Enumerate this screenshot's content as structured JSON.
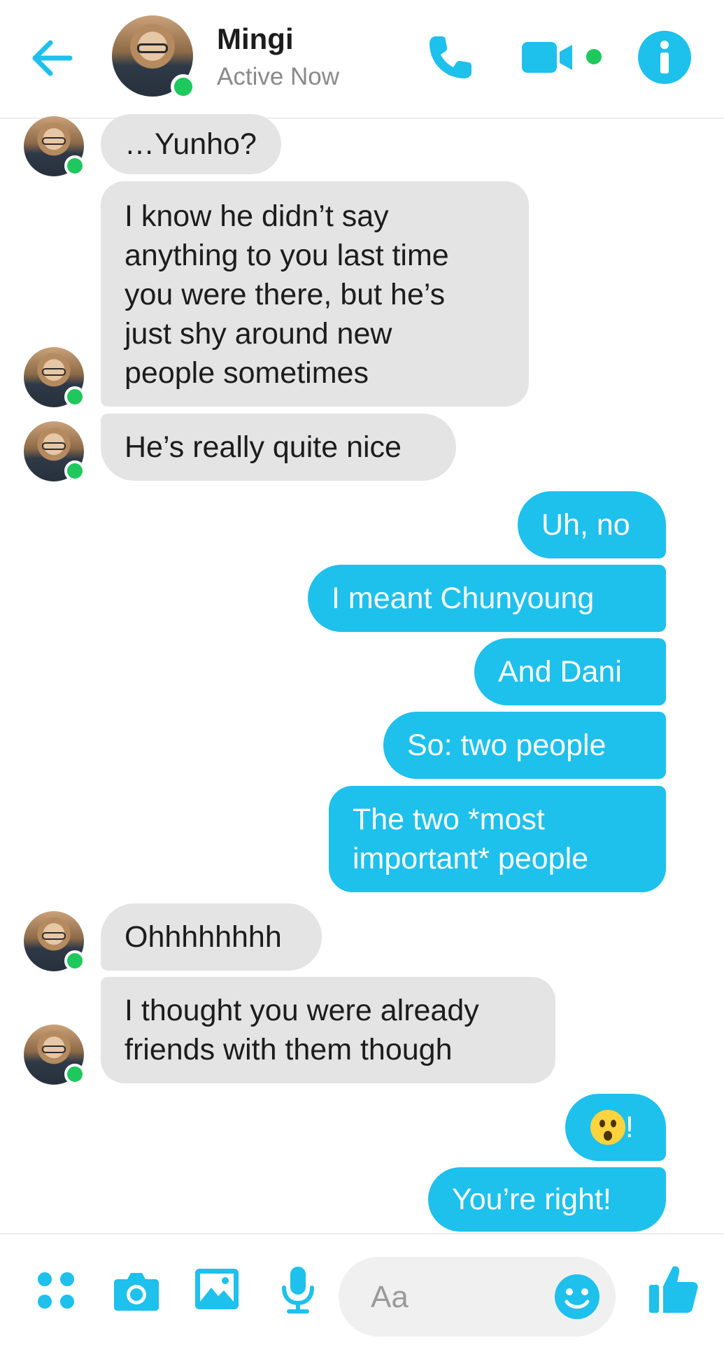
{
  "header": {
    "contact_name": "Mingi",
    "status": "Active Now",
    "accent_color": "#1ec0ec",
    "online_color": "#1ec85c",
    "icons": [
      "back-arrow-icon",
      "phone-icon",
      "video-camera-icon",
      "info-icon"
    ]
  },
  "messages": [
    {
      "side": "in",
      "lines": [
        "…Yunho?"
      ]
    },
    {
      "side": "in",
      "lines": [
        "I know he didn’t say",
        "anything to you last time",
        "you were there, but he’s",
        "just shy around new",
        "people sometimes"
      ]
    },
    {
      "side": "in",
      "lines": [
        "He’s really quite nice"
      ]
    },
    {
      "side": "out",
      "lines": [
        "Uh, no"
      ]
    },
    {
      "side": "out",
      "lines": [
        "I meant Chunyoung"
      ]
    },
    {
      "side": "out",
      "lines": [
        "And Dani"
      ]
    },
    {
      "side": "out",
      "lines": [
        "So: two people"
      ]
    },
    {
      "side": "out",
      "lines": [
        "The two *most",
        "important* people"
      ]
    },
    {
      "side": "in",
      "lines": [
        "Ohhhhhhhh"
      ]
    },
    {
      "side": "in",
      "lines": [
        "I thought you were already",
        "friends with them though"
      ]
    },
    {
      "side": "out",
      "lines": [
        "!"
      ],
      "emoji": "hushed-face-emoji"
    },
    {
      "side": "out",
      "lines": [
        "You’re right!"
      ]
    }
  ],
  "composer": {
    "placeholder": "Aa",
    "icons": [
      "apps-grid-icon",
      "camera-icon",
      "gallery-icon",
      "microphone-icon",
      "smiley-icon",
      "thumbs-up-icon"
    ]
  },
  "colors": {
    "incoming_bubble": "#e4e4e4",
    "outgoing_bubble": "#1ec0ec"
  }
}
